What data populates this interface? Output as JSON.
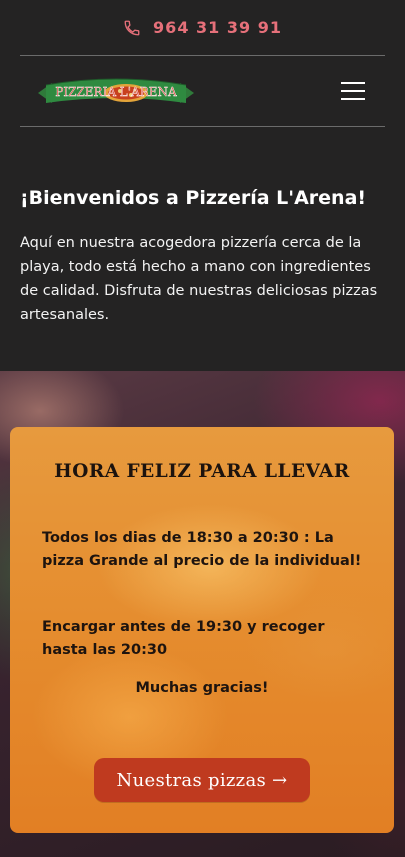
{
  "topbar": {
    "phone": "964 31 39 91",
    "phone_icon": "phone-icon"
  },
  "header": {
    "logo_text": "PIZZERIA L'ARENA",
    "menu_icon": "hamburger-menu-icon"
  },
  "welcome": {
    "title": "¡Bienvenidos a Pizzería L'Arena!",
    "body": "Aquí en nuestra acogedora pizzería cerca de la playa, todo está hecho a mano con ingredientes de calidad. Disfruta de nuestras deliciosas pizzas artesanales."
  },
  "promo": {
    "title": "HORA FELIZ PARA LLEVAR",
    "hours": "Todos los dias de 18:30 a 20:30 : La pizza Grande al precio de la individual!",
    "order": "Encargar antes de 19:30 y recoger hasta las 20:30",
    "thanks": "Muchas gracias!",
    "cta": "Nuestras pizzas →"
  },
  "colors": {
    "background": "#242323",
    "phone_accent": "#e6707a",
    "card_orange": "#e58c2e",
    "cta_red": "#bf3a1f"
  }
}
